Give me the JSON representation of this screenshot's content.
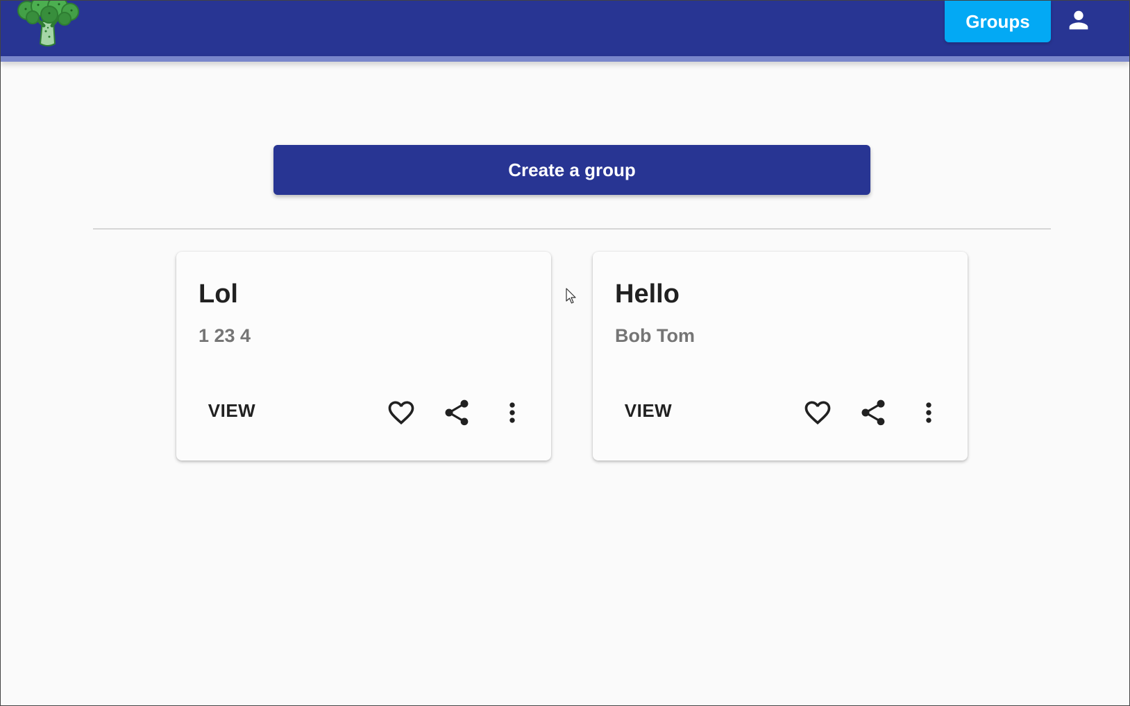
{
  "header": {
    "logo_icon": "broccoli-logo-icon",
    "groups_label": "Groups",
    "account_icon": "account-person-icon",
    "colors": {
      "bar": "#283593",
      "bar_accent": "#7986cb",
      "groups_button": "#03a9f4"
    }
  },
  "main": {
    "create_label": "Create a group",
    "groups": [
      {
        "title": "Lol",
        "members": "1 23 4",
        "view_label": "VIEW",
        "icons": [
          "heart-outline-icon",
          "share-icon",
          "more-vert-icon"
        ]
      },
      {
        "title": "Hello",
        "members": "Bob Tom",
        "view_label": "VIEW",
        "icons": [
          "heart-outline-icon",
          "share-icon",
          "more-vert-icon"
        ]
      }
    ]
  }
}
